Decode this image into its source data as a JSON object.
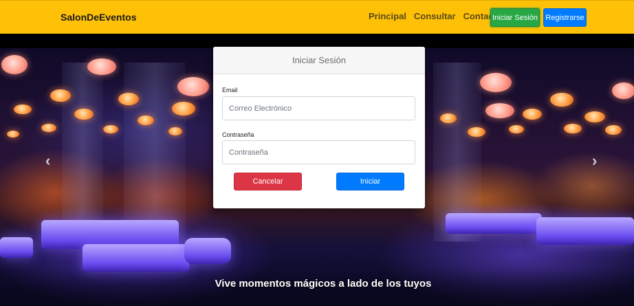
{
  "navbar": {
    "brand": "SalonDeEventos",
    "links": [
      "Principal",
      "Consultar",
      "Contacto"
    ],
    "login_label": "Iniciar Sesión",
    "register_label": "Registrarse",
    "background_color": "#ffc107"
  },
  "carousel": {
    "caption": "Vive momentos mágicos a lado de los tuyos",
    "prev_icon": "chevron-left-icon",
    "next_icon": "chevron-right-icon"
  },
  "login_modal": {
    "title": "Iniciar Sesión",
    "email_label": "Email",
    "email_placeholder": "Correo Electrónico",
    "password_label": "Contraseña",
    "password_placeholder": "Contraseña",
    "cancel_label": "Cancelar",
    "submit_label": "Iniciar",
    "cancel_color": "#dc3545",
    "submit_color": "#007bff"
  }
}
